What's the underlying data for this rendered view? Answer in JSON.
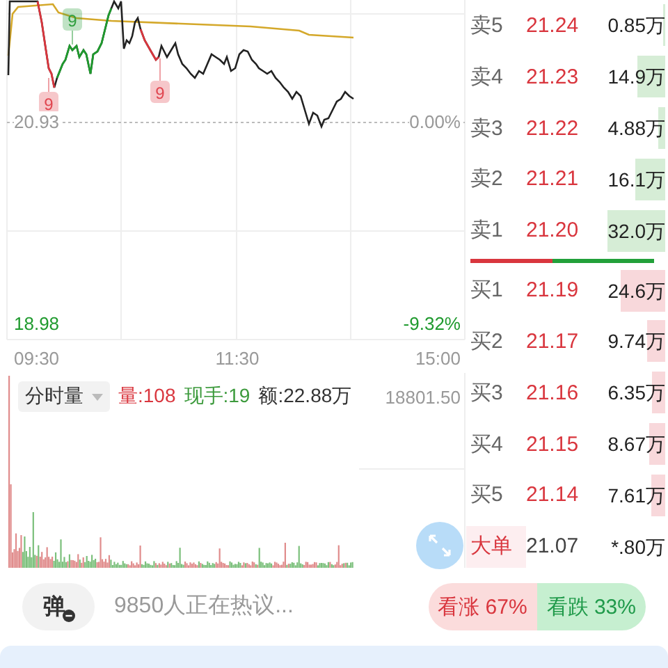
{
  "chart": {
    "reference_price": "20.93",
    "reference_change": "0.00%",
    "low_price": "18.98",
    "low_change": "-9.32%",
    "signals": [
      {
        "text": "9",
        "color": "#e0454f"
      },
      {
        "text": "9",
        "color": "#2e9e3e"
      },
      {
        "text": "9",
        "color": "#e0454f"
      }
    ],
    "time_axis": [
      "09:30",
      "11:30",
      "15:00"
    ]
  },
  "volume": {
    "mode": "分时量",
    "volume": "量:108",
    "last": "现手:19",
    "amount": "额:22.88万",
    "max": "18801.50"
  },
  "order_book": {
    "asks": [
      {
        "label": "卖5",
        "price": "21.24",
        "volume": "0.85万"
      },
      {
        "label": "卖4",
        "price": "21.23",
        "volume": "14.9万"
      },
      {
        "label": "卖3",
        "price": "21.22",
        "volume": "4.88万"
      },
      {
        "label": "卖2",
        "price": "21.21",
        "volume": "16.1万"
      },
      {
        "label": "卖1",
        "price": "21.20",
        "volume": "32.0万"
      }
    ],
    "ratio": {
      "level": 0.45
    },
    "bids": [
      {
        "label": "买1",
        "price": "21.19",
        "volume": "24.6万"
      },
      {
        "label": "买2",
        "price": "21.17",
        "volume": "9.74万"
      },
      {
        "label": "买3",
        "price": "21.16",
        "volume": "6.35万"
      },
      {
        "label": "买4",
        "price": "21.15",
        "volume": "8.67万"
      },
      {
        "label": "买5",
        "price": "21.14",
        "volume": "7.61万"
      }
    ],
    "big_order": {
      "label": "大单",
      "price": "21.07",
      "volume": "*.80万"
    }
  },
  "footer": {
    "danmaku": "弹",
    "placeholder": "9850人正在热议...",
    "bullish": "看涨 67%",
    "bearish": "看跌 33%"
  }
}
